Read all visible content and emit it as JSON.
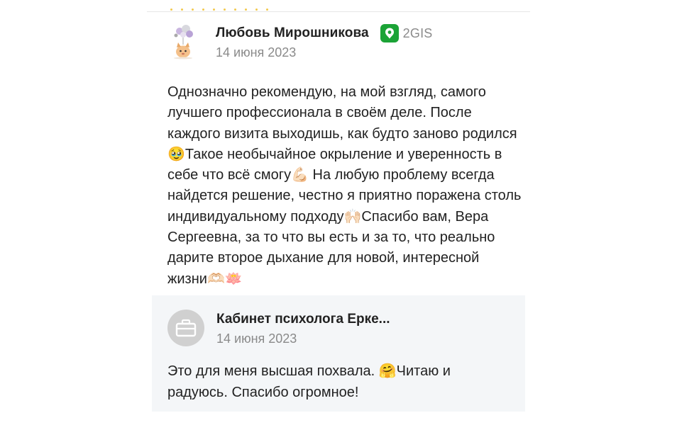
{
  "review": {
    "author_name": "Любовь Мирошникова",
    "source_name": "2GIS",
    "date": "14 июня 2023",
    "text": "Однозначно рекомендую, на мой взгляд, самого лучшего профессионала в своём деле. После каждого визита выходишь, как будто заново родился🥹Такое необычайное окрыление и уверенность в себе что всё смогу💪🏻 На любую проблему всегда найдется решение, честно я приятно поражена столь индивидуальному подходу🙌🏻Спасибо вам, Вера Сергеевна, за то что вы есть и за то, что реально дарите второе дыхание для новой, интересной жизни🫶🏻🪷",
    "avatar_icon": "cat-with-balloons-icon",
    "source_icon": "2gis-logo-icon",
    "source_color": "#1ba336"
  },
  "reply": {
    "org_name": "Кабинет психолога Ерке...",
    "date": "14 июня 2023",
    "text": "Это для меня высшая похвала. 🤗Читаю и радуюсь. Спасибо огромное!",
    "avatar_icon": "briefcase-icon",
    "background_color": "#f4f6f8"
  }
}
